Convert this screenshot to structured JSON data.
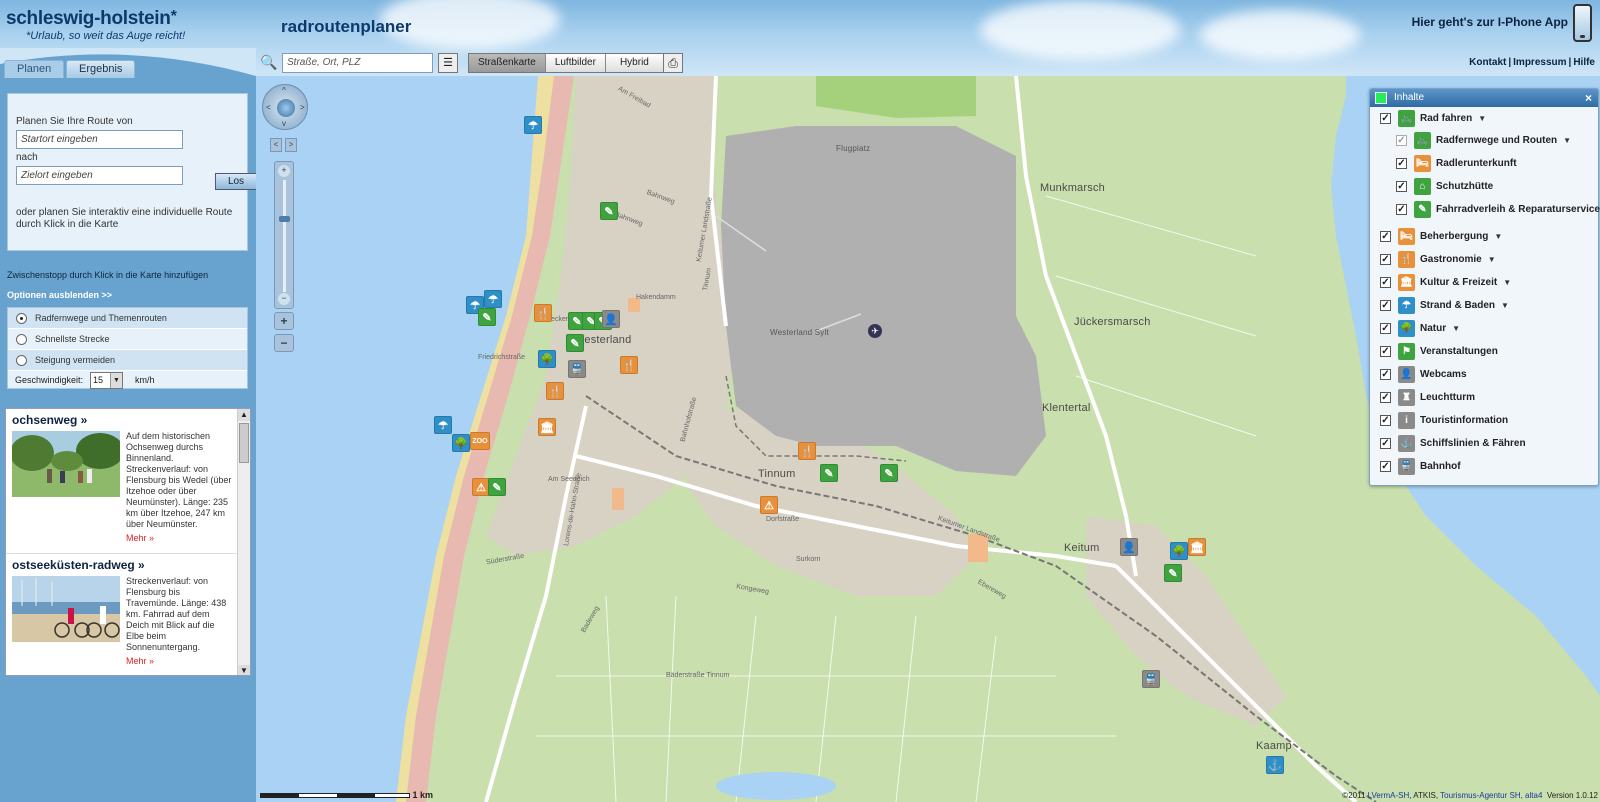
{
  "header": {
    "logo_title": "schleswig-holstein",
    "logo_star": "*",
    "logo_subtitle": "*Urlaub, so weit das Auge reicht!",
    "app_title": "radroutenplaner",
    "iphone_link": "Hier geht's zur I-Phone App",
    "links": [
      "Kontakt",
      "|",
      "Impressum",
      "|",
      "Hilfe"
    ]
  },
  "toolbar": {
    "search_placeholder": "Straße, Ort, PLZ",
    "maptypes": [
      "Straßenkarte",
      "Luftbilder",
      "Hybrid"
    ],
    "active_maptype": "Straßenkarte"
  },
  "sidebar": {
    "tabs": [
      "Planen",
      "Ergebnis"
    ],
    "plan_intro": "Planen Sie Ihre Route von",
    "start_placeholder": "Startort eingeben",
    "nach": "nach",
    "end_placeholder": "Zielort eingeben",
    "go_button": "Los",
    "plan_note": "oder planen Sie interaktiv eine individuelle Route durch Klick in die Karte",
    "stop_note": "Zwischenstopp durch Klick in die Karte hinzufügen",
    "options_toggle": "Optionen ausblenden >>",
    "options": [
      "Radfernwege und Themenrouten",
      "Schnellste Strecke",
      "Steigung vermeiden"
    ],
    "selected_option": 0,
    "speed_label": "Geschwindigkeit:",
    "speed_value": "15",
    "speed_unit": "km/h"
  },
  "routes": [
    {
      "title": "ochsenweg »",
      "text": "Auf dem historischen Ochsenweg durchs Binnenland. Streckenverlauf: von Flensburg bis Wedel (über Itzehoe oder über Neumünster). Länge: 235 km über Itzehoe, 247 km über Neumünster.",
      "more": "Mehr »"
    },
    {
      "title": "ostseeküsten-radweg »",
      "text": "Streckenverlauf: von Flensburg bis Travemünde. Länge: 438 km. Fahrrad auf dem Deich mit Blick auf die Elbe beim Sonnenuntergang.",
      "more": "Mehr »"
    }
  ],
  "map": {
    "places": [
      "Westerland",
      "Tinnum",
      "Munkmarsch",
      "Jückersmarsch",
      "Klentertal",
      "Keitum",
      "Kaamp",
      "Flugplatz",
      "Westerland Sylt"
    ],
    "streets": [
      "Am Freibad",
      "Bahnweg",
      "Friedrichstraße",
      "Deckerstraße",
      "Keitumer Landstraße",
      "Keitumer Landstraße",
      "Lorens-de-Hahn-Straße",
      "Am Seedeich",
      "Dorfstraße",
      "Süderstraße",
      "Badeweg",
      "Ebereweg",
      "Kongeweg",
      "Bäderstraße Tinnum",
      "Bahnhofstraße",
      "Surkorn",
      "Hakendamm",
      "Tinnum",
      "Bahnweg"
    ],
    "scale_label": "1 km",
    "attribution_prefix": "©2011",
    "attribution_links": [
      "LVermA-SH",
      "Tourismus-Agentur SH, alta4"
    ],
    "attribution_text": "ATKIS,",
    "version": "Version 1.0.12",
    "controls": {
      "zoom_in": "+",
      "zoom_out": "−",
      "plus": "+",
      "minus": "−",
      "rotate_left": "<",
      "rotate_right": ">",
      "up": "^",
      "down": "v",
      "left": "<",
      "right": ">"
    }
  },
  "layers": {
    "title": "Inhalte",
    "close": "×",
    "items": [
      {
        "label": "Rad fahren",
        "dropdown": true,
        "indent": false,
        "color": "#3fa33f",
        "glyph": "🚲",
        "checked": true
      },
      {
        "label": "Radfernwege und Routen",
        "dropdown": true,
        "indent": true,
        "color": "#3fa33f",
        "glyph": "🚲",
        "checked": true,
        "disabled": true
      },
      {
        "label": "Radlerunterkunft",
        "dropdown": false,
        "indent": true,
        "color": "#e9913a",
        "glyph": "🛏",
        "checked": true
      },
      {
        "label": "Schutzhütte",
        "dropdown": false,
        "indent": true,
        "color": "#3fa33f",
        "glyph": "⌂",
        "checked": true
      },
      {
        "label": "Fahrradverleih & Reparaturservice",
        "dropdown": false,
        "indent": true,
        "color": "#3fa33f",
        "glyph": "✎",
        "checked": true
      },
      {
        "label": "Beherbergung",
        "dropdown": true,
        "indent": false,
        "color": "#e9913a",
        "glyph": "🛏",
        "checked": true
      },
      {
        "label": "Gastronomie",
        "dropdown": true,
        "indent": false,
        "color": "#e9913a",
        "glyph": "🍴",
        "checked": true
      },
      {
        "label": "Kultur & Freizeit",
        "dropdown": true,
        "indent": false,
        "color": "#e9913a",
        "glyph": "🏛",
        "checked": true
      },
      {
        "label": "Strand & Baden",
        "dropdown": true,
        "indent": false,
        "color": "#2f8fc7",
        "glyph": "☂",
        "checked": true
      },
      {
        "label": "Natur",
        "dropdown": true,
        "indent": false,
        "color": "#2f8fc7",
        "glyph": "🌳",
        "checked": true
      },
      {
        "label": "Veranstaltungen",
        "dropdown": false,
        "indent": false,
        "color": "#3fa33f",
        "glyph": "⚑",
        "checked": true
      },
      {
        "label": "Webcams",
        "dropdown": false,
        "indent": false,
        "color": "#8a8a8a",
        "glyph": "👤",
        "checked": true
      },
      {
        "label": "Leuchtturm",
        "dropdown": false,
        "indent": false,
        "color": "#8a8a8a",
        "glyph": "♜",
        "checked": true
      },
      {
        "label": "Touristinformation",
        "dropdown": false,
        "indent": false,
        "color": "#8a8a8a",
        "glyph": "i",
        "checked": true
      },
      {
        "label": "Schiffslinien & Fähren",
        "dropdown": false,
        "indent": false,
        "color": "#8a8a8a",
        "glyph": "⚓",
        "checked": true
      },
      {
        "label": "Bahnhof",
        "dropdown": false,
        "indent": false,
        "color": "#8a8a8a",
        "glyph": "🚆",
        "checked": true
      }
    ]
  },
  "pois": [
    {
      "type": "blue",
      "glyph": "☂"
    },
    {
      "type": "green",
      "glyph": "✎"
    },
    {
      "type": "blue",
      "glyph": "☂"
    },
    {
      "type": "blue",
      "glyph": "☂"
    },
    {
      "type": "green",
      "glyph": "✎"
    },
    {
      "type": "orange",
      "glyph": "🍴"
    },
    {
      "type": "green",
      "glyph": "✎"
    },
    {
      "type": "green",
      "glyph": "✎"
    },
    {
      "type": "green",
      "glyph": "✎"
    },
    {
      "type": "gray",
      "glyph": "👤"
    },
    {
      "type": "green",
      "glyph": "✎"
    },
    {
      "type": "blue",
      "glyph": "🌳"
    },
    {
      "type": "orange",
      "glyph": "🍴"
    },
    {
      "type": "gray",
      "glyph": "🚆"
    },
    {
      "type": "orange",
      "glyph": "🍴"
    },
    {
      "type": "blue",
      "glyph": "☂"
    },
    {
      "type": "blue",
      "glyph": "🌳"
    },
    {
      "type": "orange",
      "glyph": "ZOO"
    },
    {
      "type": "orange",
      "glyph": "🏛"
    },
    {
      "type": "orange",
      "glyph": "⚠"
    },
    {
      "type": "green",
      "glyph": "✎"
    },
    {
      "type": "orange",
      "glyph": "🍴"
    },
    {
      "type": "green",
      "glyph": "✎"
    },
    {
      "type": "green",
      "glyph": "✎"
    },
    {
      "type": "orange",
      "glyph": "⚠"
    },
    {
      "type": "gray",
      "glyph": "👤"
    },
    {
      "type": "blue",
      "glyph": "🌳"
    },
    {
      "type": "orange",
      "glyph": "🏛"
    },
    {
      "type": "green",
      "glyph": "✎"
    },
    {
      "type": "gray",
      "glyph": "🚆"
    },
    {
      "type": "blue",
      "glyph": "⚓"
    }
  ]
}
